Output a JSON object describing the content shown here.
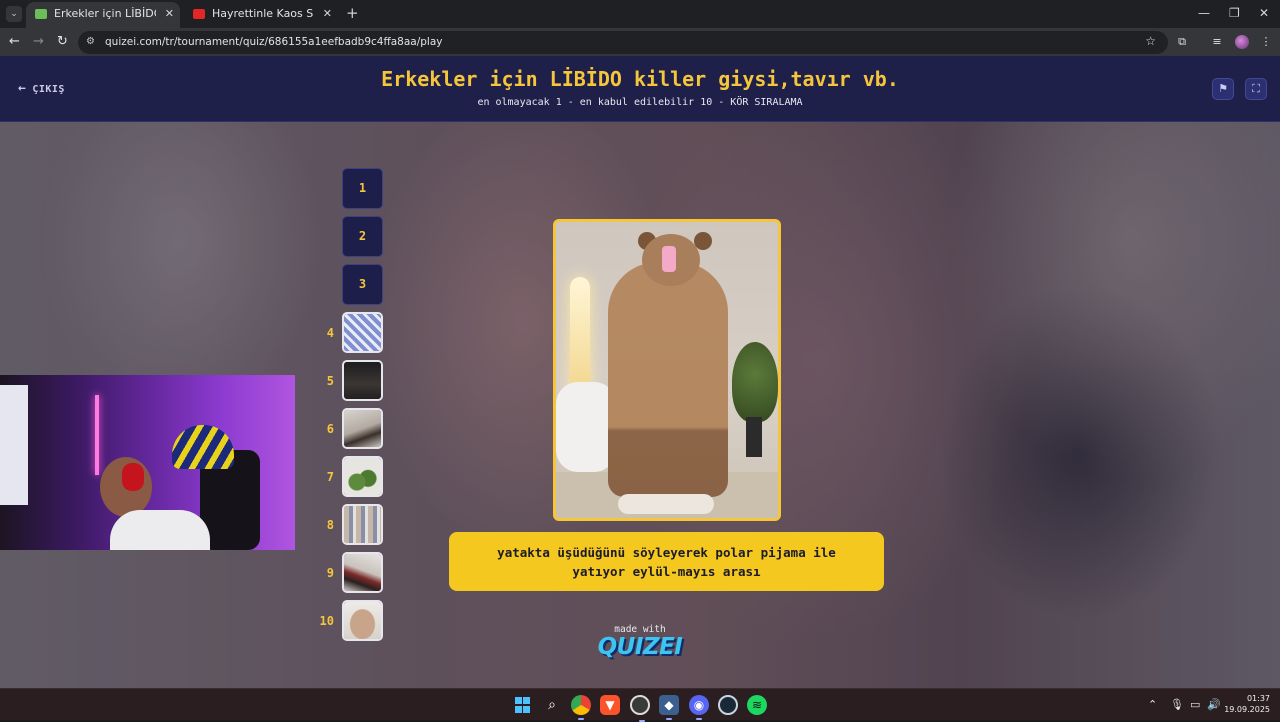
{
  "browser": {
    "tabs": [
      {
        "label": "Erkekler için LİBİDO killer giysi,tavır vb.",
        "active": true,
        "favicon_color": "#6bbf59"
      },
      {
        "label": "Hayrettinle Kaos Show - Altın çağ",
        "active": false,
        "favicon_color": "#e32626"
      }
    ],
    "new_tab_icon": "plus-icon",
    "url": "quizei.com/tr/tournament/quiz/686155a1eefbadb9c4ffa8aa/play",
    "window_controls": [
      "minimize-icon",
      "restore-icon",
      "close-icon"
    ]
  },
  "header": {
    "exit_label": "ÇIKIŞ",
    "title": "Erkekler için LİBİDO killer giysi,tavır vb.",
    "subtitle": "en olmayacak 1 - en kabul edilebilir 10 - KÖR SIRALAMA",
    "buttons": [
      "flag-icon",
      "fullscreen-icon"
    ]
  },
  "slots": [
    {
      "rank": "1",
      "filled": false
    },
    {
      "rank": "2",
      "filled": false
    },
    {
      "rank": "3",
      "filled": false
    },
    {
      "rank": "4",
      "filled": true,
      "thumb": "blue-floral-dress"
    },
    {
      "rank": "5",
      "filled": true,
      "thumb": "dark-scene"
    },
    {
      "rank": "6",
      "filled": true,
      "thumb": "person-on-bed"
    },
    {
      "rank": "7",
      "filled": true,
      "thumb": "crocs-shoes"
    },
    {
      "rank": "8",
      "filled": true,
      "thumb": "group-of-men"
    },
    {
      "rank": "9",
      "filled": true,
      "thumb": "person-lying-down"
    },
    {
      "rank": "10",
      "filled": true,
      "thumb": "sleeping-person"
    }
  ],
  "current_item": {
    "image": "brown-bear-fleece-onesie-pajama",
    "caption": "yatakta üşüdüğünü söyleyerek polar pijama ile yatıyor eylül-mayıs arası"
  },
  "branding": {
    "made_with": "made with",
    "logo": "QUIZEI"
  },
  "taskbar": {
    "apps": [
      "windows-start-icon",
      "search-icon",
      "chrome-icon",
      "brave-icon",
      "obs-icon",
      "app-icon",
      "discord-icon",
      "steam-icon",
      "spotify-icon"
    ],
    "time": "01:37",
    "date": "19.09.2025"
  },
  "colors": {
    "accent_yellow": "#f5c63c",
    "header_bg": "#1e2049",
    "caption_bg": "#f5c81f",
    "logo_blue": "#3cc4f2"
  }
}
